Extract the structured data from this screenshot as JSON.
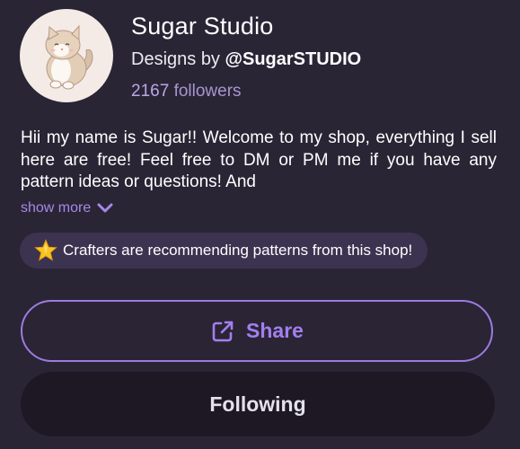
{
  "profile": {
    "name": "Sugar Studio",
    "designs_by_prefix": "Designs by",
    "handle": "@SugarSTUDIO",
    "followers_count": "2167",
    "followers_label": "followers",
    "avatar_icon": "cat-avatar"
  },
  "bio": {
    "text": "Hii my name is Sugar!! Welcome to my shop, everything I sell here are free! Feel free to DM or PM me if you have any pattern ideas or questions! And",
    "show_more_label": "show more",
    "show_more_icon": "chevron-down-icon"
  },
  "recommendation": {
    "icon": "star-icon",
    "text": "Crafters are recommending patterns from this shop!"
  },
  "actions": {
    "share_label": "Share",
    "share_icon": "share-external-icon",
    "following_label": "Following"
  },
  "colors": {
    "background": "#2a2535",
    "accent": "#a27fef",
    "followers": "#a796cf",
    "badge_bg": "#3c3350",
    "following_bg": "#1d1823"
  }
}
